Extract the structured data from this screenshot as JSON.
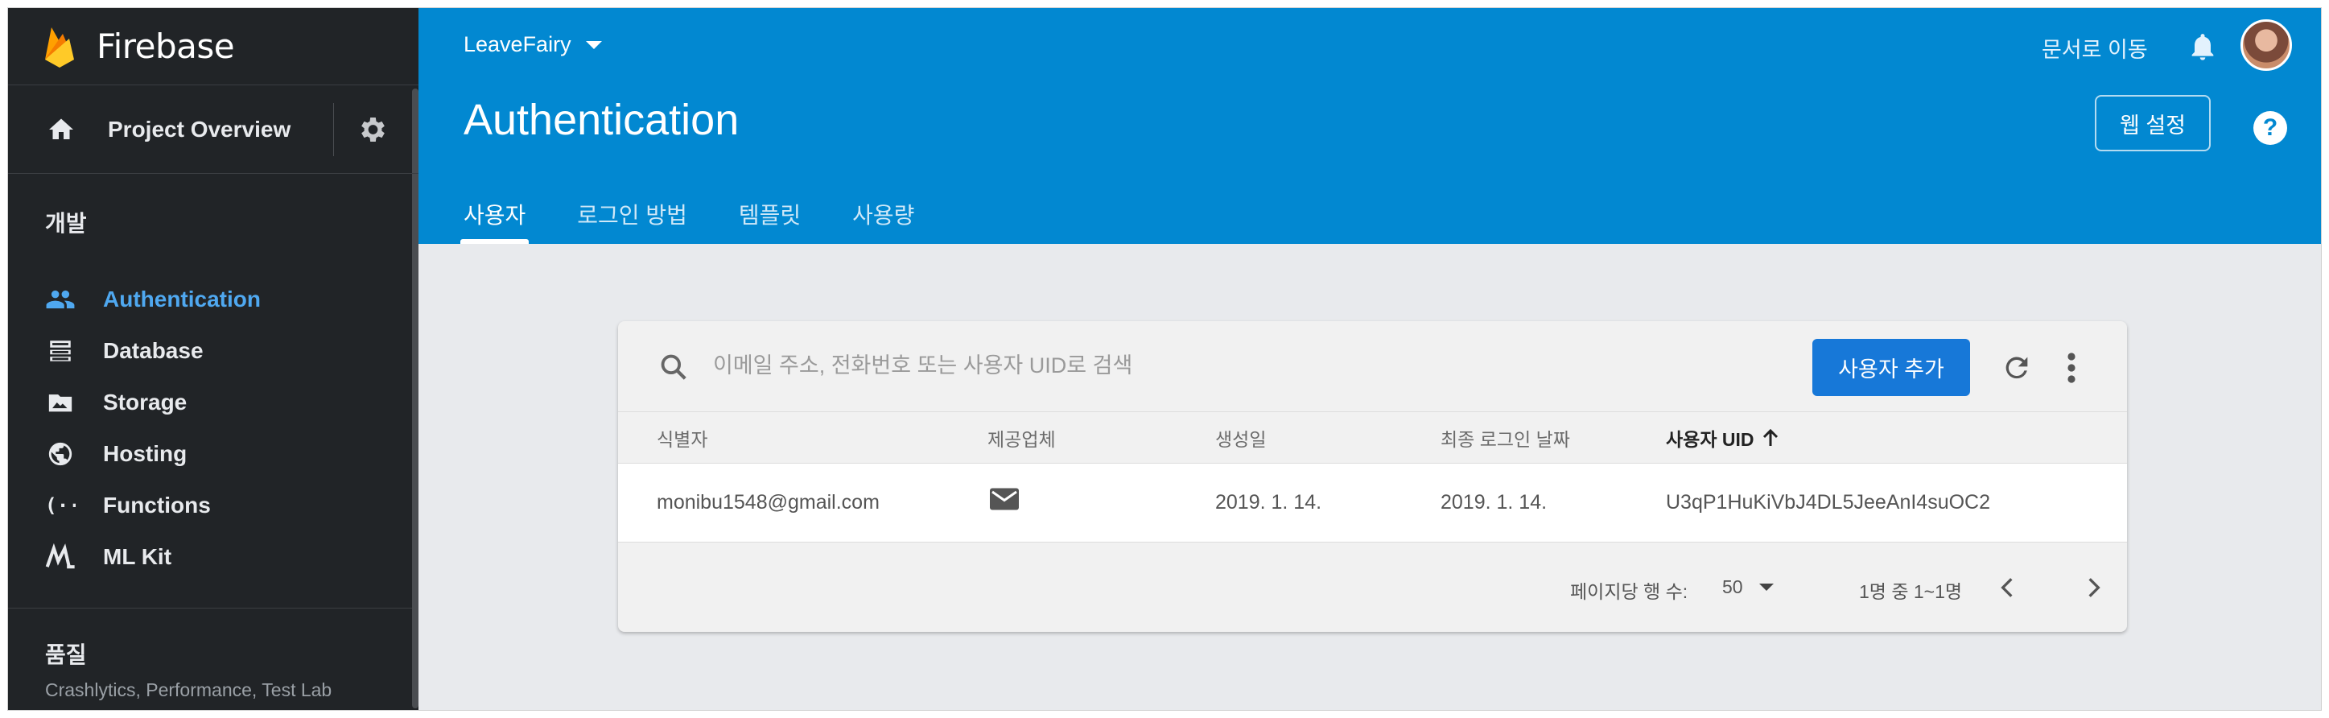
{
  "sidebar": {
    "brand": "Firebase",
    "overview_label": "Project Overview",
    "section_dev": "개발",
    "items": [
      {
        "label": "Authentication",
        "icon": "people-icon",
        "active": true
      },
      {
        "label": "Database",
        "icon": "database-icon",
        "active": false
      },
      {
        "label": "Storage",
        "icon": "storage-icon",
        "active": false
      },
      {
        "label": "Hosting",
        "icon": "globe-icon",
        "active": false
      },
      {
        "label": "Functions",
        "icon": "functions-icon",
        "active": false
      },
      {
        "label": "ML Kit",
        "icon": "ml-kit-icon",
        "active": false
      }
    ],
    "quality": {
      "title": "품질",
      "subtitle": "Crashlytics, Performance, Test Lab"
    }
  },
  "header": {
    "project": "LeaveFairy",
    "title": "Authentication",
    "docs_link": "문서로 이동",
    "web_setup": "웹 설정",
    "help": "?",
    "tabs": [
      {
        "label": "사용자",
        "active": true
      },
      {
        "label": "로그인 방법",
        "active": false
      },
      {
        "label": "템플릿",
        "active": false
      },
      {
        "label": "사용량",
        "active": false
      }
    ]
  },
  "card": {
    "search_placeholder": "이메일 주소, 전화번호 또는 사용자 UID로 검색",
    "add_user": "사용자 추가",
    "columns": [
      "식별자",
      "제공업체",
      "생성일",
      "최종 로그인 날짜",
      "사용자 UID"
    ],
    "rows": [
      {
        "identifier": "monibu1548@gmail.com",
        "provider": "email-icon",
        "created": "2019. 1. 14.",
        "last_login": "2019. 1. 14.",
        "uid": "U3qP1HuKiVbJ4DL5JeeAnI4suOC2"
      }
    ],
    "footer": {
      "rows_per_page_label": "페이지당 행 수:",
      "rows_per_page_value": "50",
      "range": "1명 중 1~1명"
    }
  },
  "colors": {
    "sidebar_bg": "#212427",
    "header_bg": "#0288d1",
    "accent": "#4fa8f0",
    "button": "#1778d8"
  }
}
